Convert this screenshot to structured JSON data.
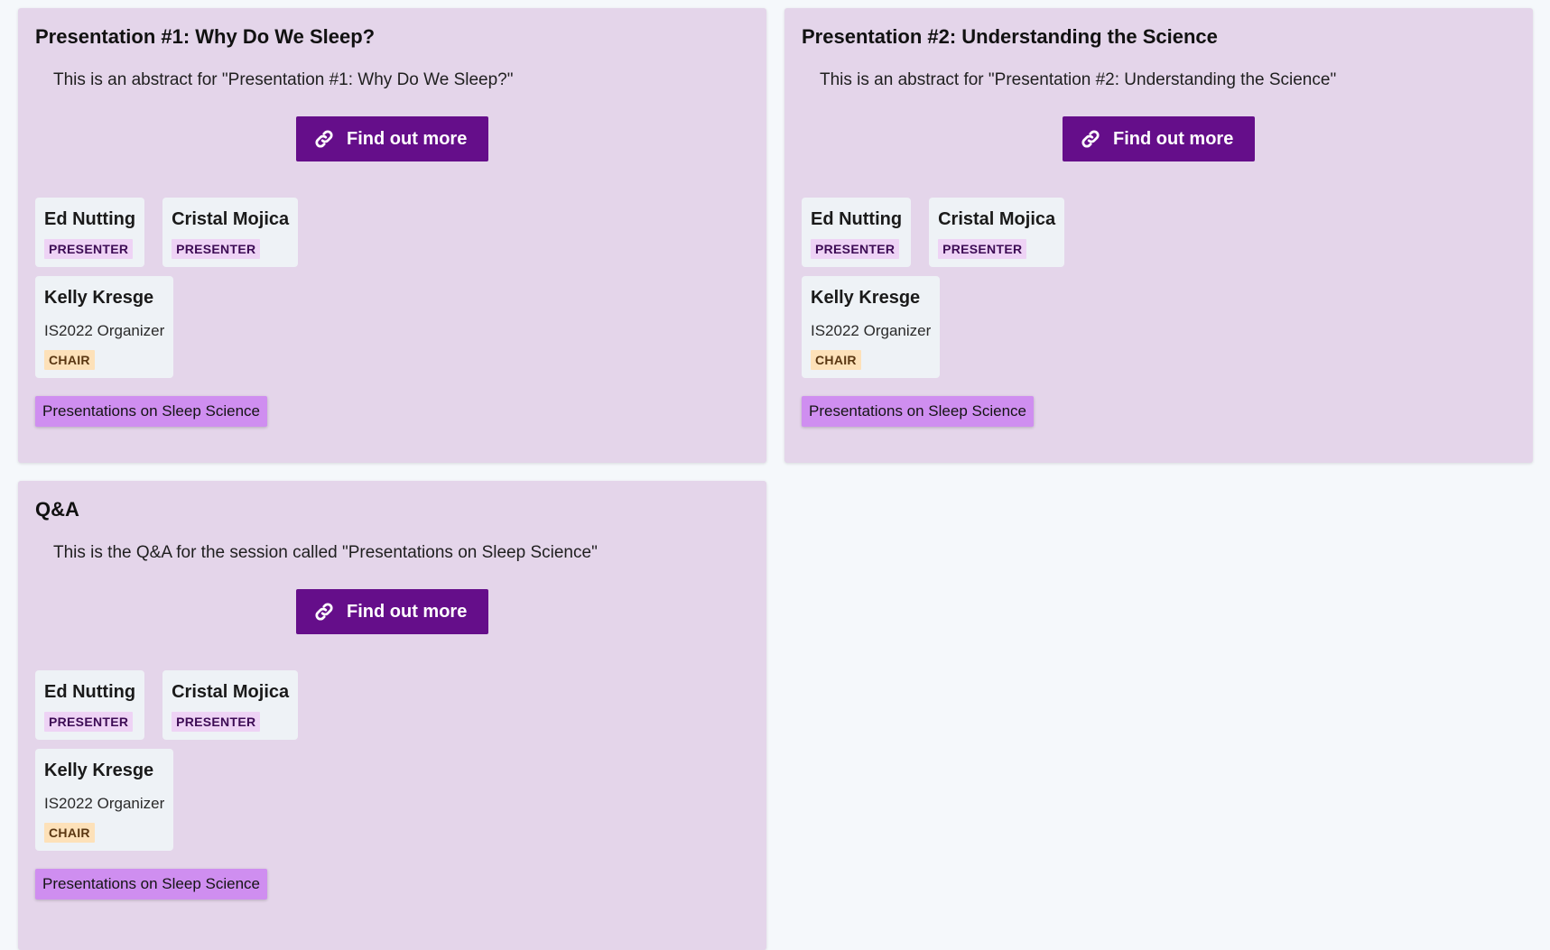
{
  "cards": [
    {
      "title": "Presentation #1: Why Do We Sleep?",
      "abstract": "This is an abstract for \"Presentation #1: Why Do We Sleep?\"",
      "button_label": "Find out more",
      "people": [
        {
          "name": "Ed Nutting",
          "role": "PRESENTER"
        },
        {
          "name": "Cristal Mojica",
          "role": "PRESENTER"
        },
        {
          "name": "Kelly Kresge",
          "affiliation": "IS2022 Organizer",
          "role": "CHAIR"
        }
      ],
      "session_tag": "Presentations on Sleep Science"
    },
    {
      "title": "Presentation #2: Understanding the Science",
      "abstract": "This is an abstract for \"Presentation #2: Understanding the Science\"",
      "button_label": "Find out more",
      "people": [
        {
          "name": "Ed Nutting",
          "role": "PRESENTER"
        },
        {
          "name": "Cristal Mojica",
          "role": "PRESENTER"
        },
        {
          "name": "Kelly Kresge",
          "affiliation": "IS2022 Organizer",
          "role": "CHAIR"
        }
      ],
      "session_tag": "Presentations on Sleep Science"
    },
    {
      "title": "Q&A",
      "abstract": "This is the Q&A for the session called \"Presentations on Sleep Science\"",
      "button_label": "Find out more",
      "people": [
        {
          "name": "Ed Nutting",
          "role": "PRESENTER"
        },
        {
          "name": "Cristal Mojica",
          "role": "PRESENTER"
        },
        {
          "name": "Kelly Kresge",
          "affiliation": "IS2022 Organizer",
          "role": "CHAIR"
        }
      ],
      "session_tag": "Presentations on Sleep Science"
    }
  ],
  "icons": {
    "button_icon": "link-icon"
  },
  "colors": {
    "card_background": "#e4d5ea",
    "button": "#650e8a",
    "presenter_badge": "#eed3f5",
    "chair_badge": "#fde1b9",
    "session_tag": "#cf8ef0",
    "page_background": "#f5f8fb"
  }
}
